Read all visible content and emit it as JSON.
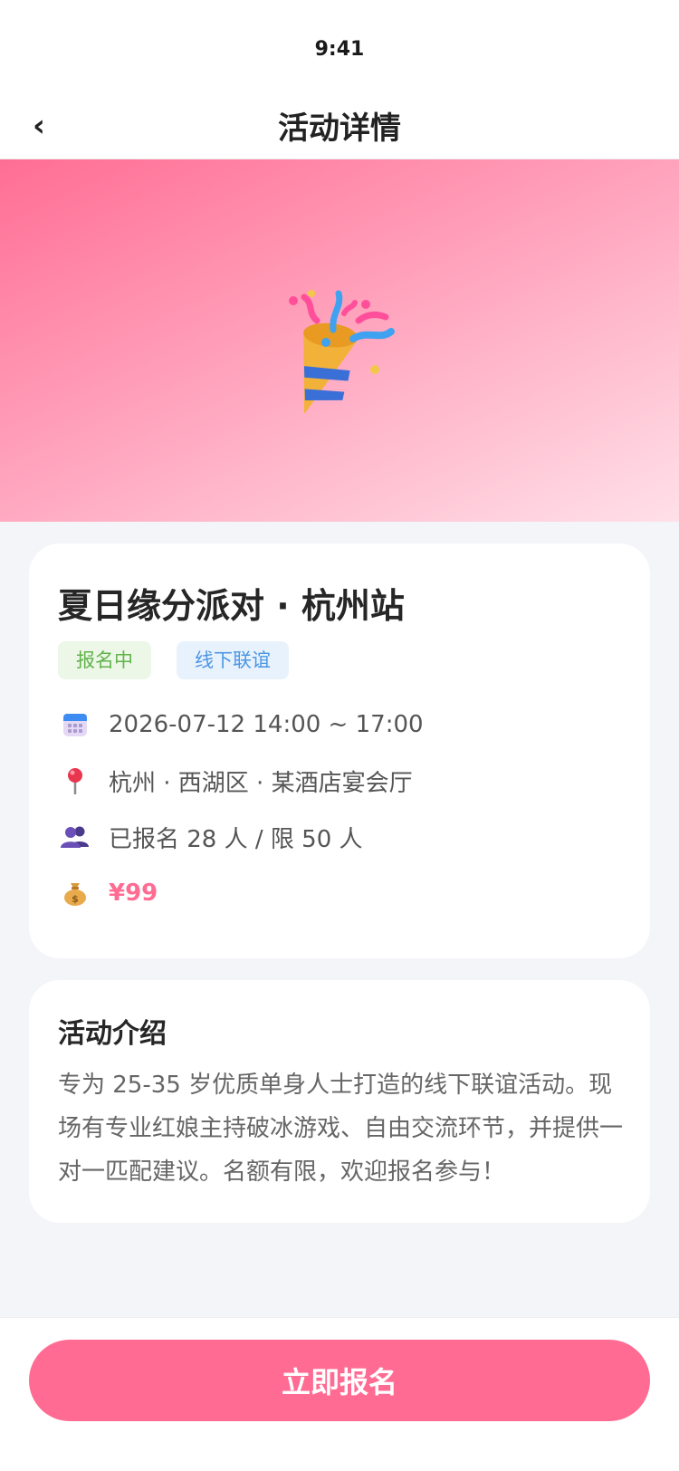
{
  "status_bar": {
    "time": "9:41"
  },
  "nav": {
    "back_icon": "chevron-left-icon",
    "back_glyph": "‹",
    "title": "活动详情"
  },
  "hero": {
    "icon": "party-popper-icon",
    "gradient_colors": [
      "#ff6e94",
      "#ffe0e8"
    ]
  },
  "event": {
    "title": "夏日缘分派对 · 杭州站",
    "tags": [
      {
        "label": "报名中",
        "color": "#62b34b"
      },
      {
        "label": "线下联谊",
        "color": "#4d97e2"
      }
    ],
    "info": {
      "date": {
        "icon": "calendar-icon",
        "text": "2026-07-12 14:00 ~ 17:00"
      },
      "location": {
        "icon": "pin-icon",
        "text": "杭州 · 西湖区 · 某酒店宴会厅"
      },
      "signup": {
        "icon": "people-icon",
        "text": "已报名 28 人 / 限 50 人"
      },
      "price": {
        "icon": "money-bag-icon",
        "text": "¥99"
      }
    }
  },
  "intro": {
    "title": "活动介绍",
    "body": "专为 25-35 岁优质单身人士打造的线下联谊活动。现场有专业红娘主持破冰游戏、自由交流环节，并提供一对一匹配建议。名额有限，欢迎报名参与！"
  },
  "cta": {
    "label": "立即报名",
    "color": "#ff6b93"
  }
}
